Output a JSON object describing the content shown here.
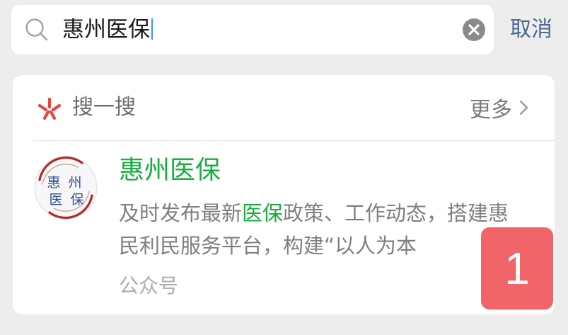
{
  "search": {
    "query": "惠州医保",
    "cancel_label": "取消"
  },
  "section": {
    "title": "搜一搜",
    "more_label": "更多"
  },
  "result": {
    "title": "惠州医保",
    "desc_before": "及时发布最新",
    "desc_highlight": "医保",
    "desc_after": "政策、工作动态，搭建惠民利民服务平台，构建“以人为本",
    "type_label": "公众号",
    "avatar_text": [
      "惠",
      "州",
      "医",
      "保"
    ]
  },
  "badge": {
    "number": "1"
  },
  "colors": {
    "background": "#ededed",
    "card": "#ffffff",
    "accent_green": "#1aad3f",
    "link_blue": "#4c6890",
    "badge_red": "#f16467"
  }
}
